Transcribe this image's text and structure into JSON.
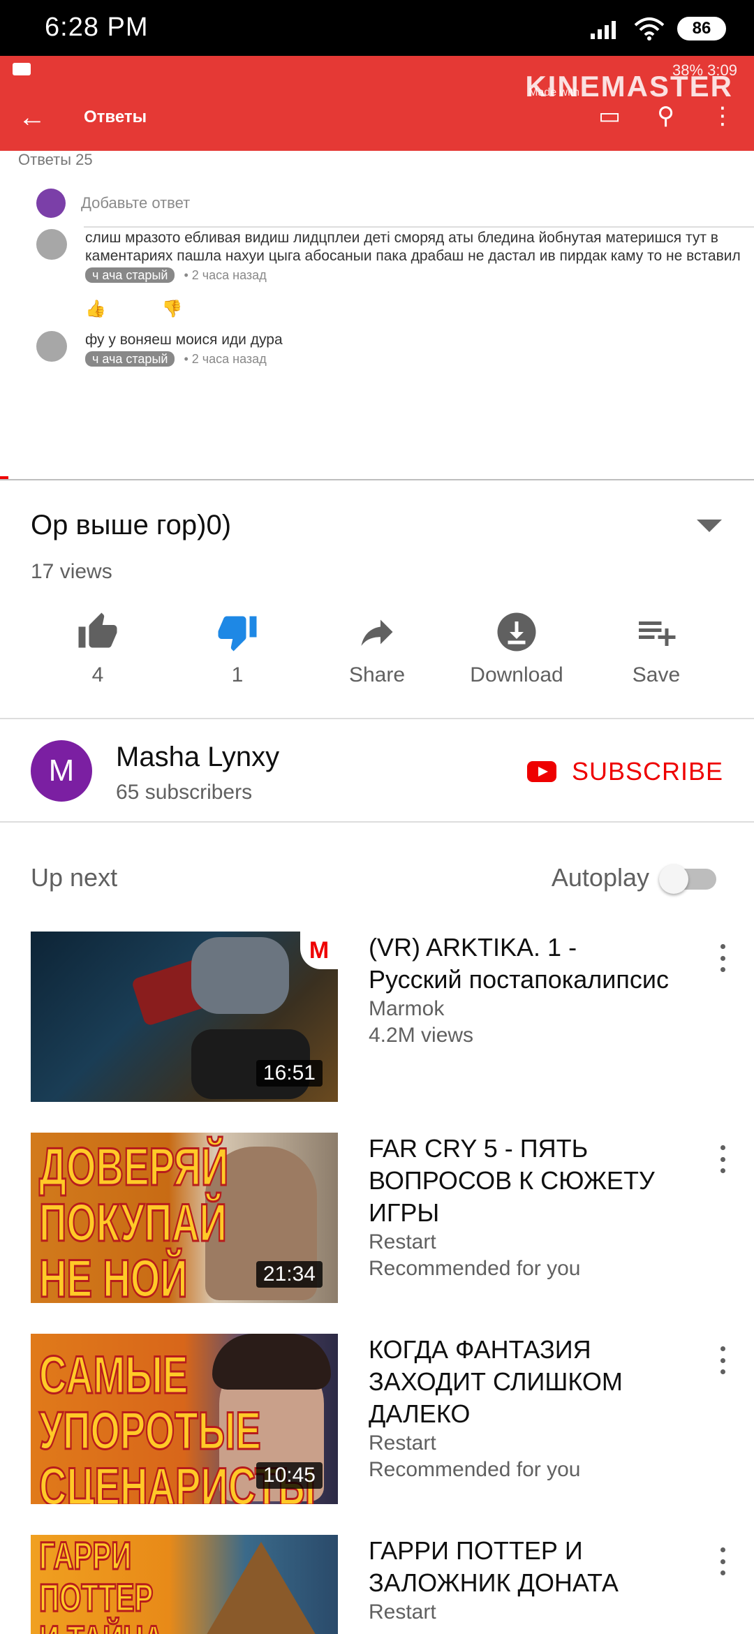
{
  "status_bar": {
    "time": "6:28 PM",
    "battery": "86"
  },
  "video_overlay": {
    "status_right": "38% 3:09",
    "watermark": "KINEMASTER",
    "watermark_sub": "Made with",
    "appbar_title": "Ответы",
    "cut_text": "Ответы 25",
    "reply_placeholder": "Добавьте ответ",
    "comments": [
      {
        "text": "слиш мразото ебливая видиш лидцплеи деті сморяд аты бледина йобнутая материшся тут в каментариях пашла нахуи цыга абосаныи пака драбаш не дастал ив пирдак каму  то не вставил",
        "badge": "ч ача старый",
        "time": "• 2 часа назад"
      },
      {
        "text": "фу у воняеш моися иди дура",
        "badge": "ч ача старый",
        "time": "• 2 часа назад"
      }
    ]
  },
  "video": {
    "title": "Ор выше гор)0)",
    "views": "17 views",
    "actions": {
      "like": "4",
      "dislike": "1",
      "share": "Share",
      "download": "Download",
      "save": "Save"
    }
  },
  "channel": {
    "avatar_letter": "M",
    "name": "Masha Lynxy",
    "subscribers": "65 subscribers",
    "subscribe_label": "SUBSCRIBE"
  },
  "up_next": {
    "label": "Up next",
    "autoplay_label": "Autoplay",
    "autoplay_on": false,
    "items": [
      {
        "title": "(VR) ARKTIKA. 1 - Русский постапокалипсис",
        "channel": "Marmok",
        "sub": "4.2M views",
        "duration": "16:51"
      },
      {
        "title": "FAR CRY 5 - ПЯТЬ ВОПРОСОВ К СЮЖЕТУ ИГРЫ",
        "channel": "Restart",
        "sub": "Recommended for you",
        "duration": "21:34",
        "thumb_text": "ДОВЕРЯЙ ПОКУПАЙ НЕ НОЙ"
      },
      {
        "title": "КОГДА ФАНТАЗИЯ ЗАХОДИТ СЛИШКОМ ДАЛЕКО",
        "channel": "Restart",
        "sub": "Recommended for you",
        "duration": "10:45",
        "thumb_text": "САМЫЕ УПОРОТЫЕ СЦЕНАРИСТЫ"
      },
      {
        "title": "ГАРРИ ПОТТЕР И ЗАЛОЖНИК ДОНАТА",
        "channel": "Restart",
        "thumb_text": "ГАРРИ ПОТТЕР И ТАЙНА ДОНАТА"
      }
    ]
  },
  "colors": {
    "accent": "#e00000",
    "muted": "#606060"
  }
}
